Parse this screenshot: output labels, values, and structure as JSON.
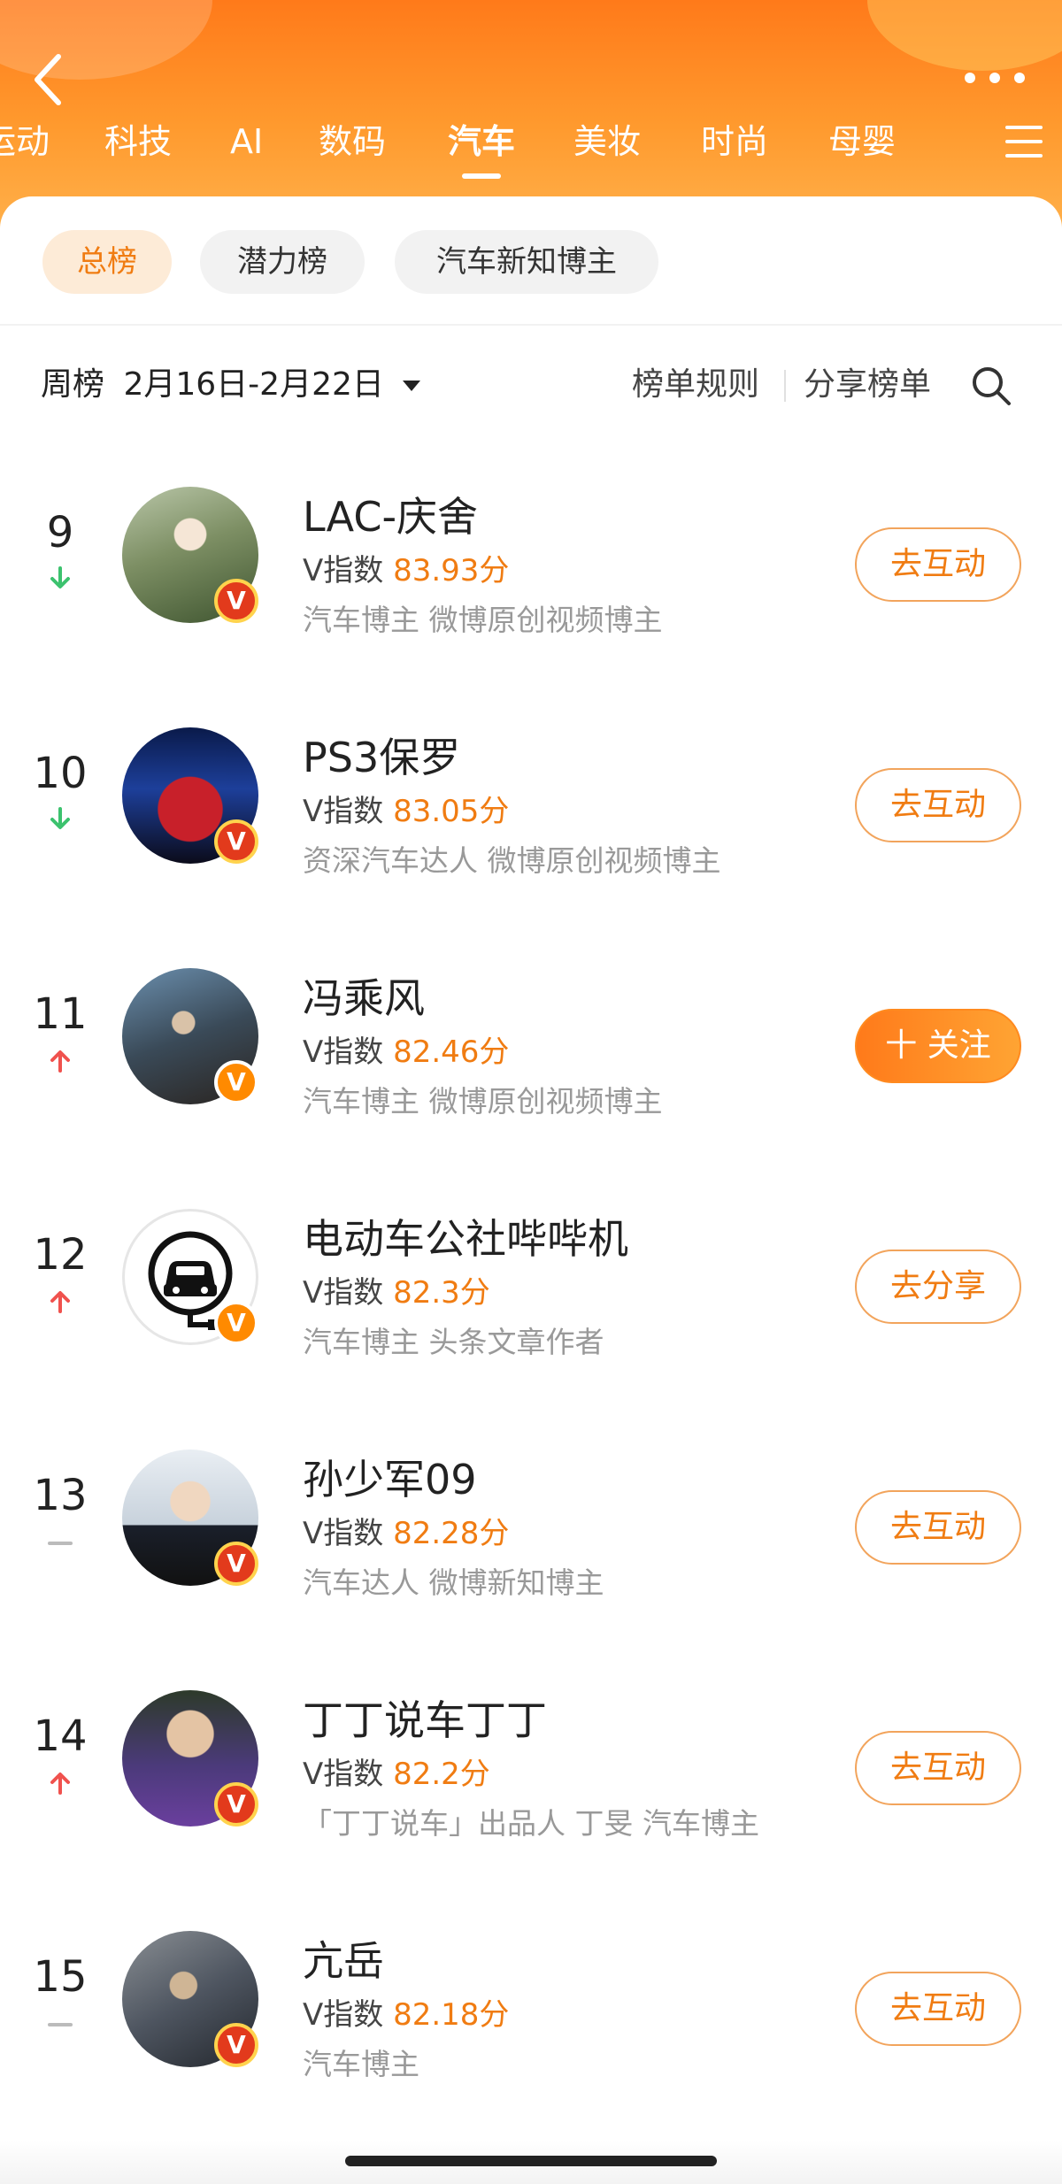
{
  "colors": {
    "accent": "#f07c12",
    "header_gradient_top": "#ff7a1a",
    "header_gradient_bottom": "#ffb04a",
    "trend_up": "#f0524e",
    "trend_down": "#3cc26e",
    "trend_flat": "#bbbbbb"
  },
  "header": {
    "back_icon": "chevron-left-icon",
    "more_icon": "more-horizontal-icon",
    "menu_icon": "hamburger-menu-icon",
    "tabs": [
      {
        "label": "运动"
      },
      {
        "label": "科技"
      },
      {
        "label": "AI"
      },
      {
        "label": "数码"
      },
      {
        "label": "汽车",
        "active": true
      },
      {
        "label": "美妆"
      },
      {
        "label": "时尚"
      },
      {
        "label": "母婴"
      }
    ]
  },
  "sub_tabs": [
    {
      "label": "总榜",
      "active": true
    },
    {
      "label": "潜力榜"
    },
    {
      "label": "汽车新知博主"
    }
  ],
  "toolbar": {
    "period_type": "周榜",
    "period_range": "2月16日-2月22日",
    "rules_label": "榜单规则",
    "share_label": "分享榜单",
    "search_icon": "search-icon"
  },
  "rows": [
    {
      "rank": "9",
      "trend": "down",
      "name": "LAC-庆舍",
      "v_label": "V指数",
      "score": "83.93分",
      "desc": "汽车博主 微博原创视频博主",
      "action": "去互动",
      "action_style": "outline",
      "badge": "red"
    },
    {
      "rank": "10",
      "trend": "down",
      "name": "PS3保罗",
      "v_label": "V指数",
      "score": "83.05分",
      "desc": "资深汽车达人 微博原创视频博主",
      "action": "去互动",
      "action_style": "outline",
      "badge": "red"
    },
    {
      "rank": "11",
      "trend": "up",
      "name": "冯乘风",
      "v_label": "V指数",
      "score": "82.46分",
      "desc": "汽车博主 微博原创视频博主",
      "action": "十 关注",
      "action_style": "primary",
      "badge": "orange"
    },
    {
      "rank": "12",
      "trend": "up",
      "name": "电动车公社哔哔机",
      "v_label": "V指数",
      "score": "82.3分",
      "desc": "汽车博主 头条文章作者",
      "action": "去分享",
      "action_style": "outline",
      "badge": "orange"
    },
    {
      "rank": "13",
      "trend": "flat",
      "name": "孙少军09",
      "v_label": "V指数",
      "score": "82.28分",
      "desc": "汽车达人 微博新知博主",
      "action": "去互动",
      "action_style": "outline",
      "badge": "red"
    },
    {
      "rank": "14",
      "trend": "up",
      "name": "丁丁说车丁丁",
      "v_label": "V指数",
      "score": "82.2分",
      "desc": "「丁丁说车」出品人 丁旻 汽车博主",
      "action": "去互动",
      "action_style": "outline",
      "badge": "red"
    },
    {
      "rank": "15",
      "trend": "flat",
      "name": "亢岳",
      "v_label": "V指数",
      "score": "82.18分",
      "desc": "汽车博主",
      "action": "去互动",
      "action_style": "outline",
      "badge": "red"
    }
  ]
}
